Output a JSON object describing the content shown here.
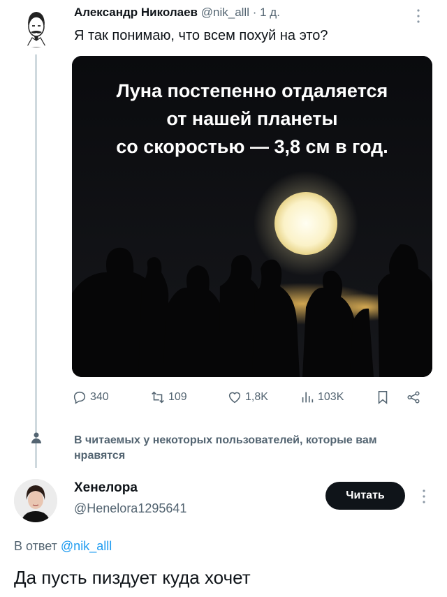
{
  "tweet": {
    "author_name": "Александр Николаев",
    "handle": "@nik_alll",
    "separator": "·",
    "time": "1 д.",
    "text": "Я так понимаю, что всем похуй на это?",
    "media_caption": [
      "Луна постепенно отдаляется",
      "от нашей планеты",
      "со скоростью — 3,8 см в год."
    ],
    "stats": {
      "replies": "340",
      "retweets": "109",
      "likes": "1,8K",
      "views": "103K"
    }
  },
  "social_context": {
    "text": "В читаемых у некоторых пользователей, которые вам нравятся"
  },
  "reply": {
    "author_name": "Хенелора",
    "handle": "@Henelora1295641",
    "follow_label": "Читать",
    "reply_to_label": "В ответ",
    "reply_to_handle": "@nik_alll",
    "text": "Да пусть пиздует куда хочет"
  },
  "colors": {
    "link": "#1d9bf0",
    "secondary_text": "#536471",
    "primary_text": "#0f1419"
  }
}
